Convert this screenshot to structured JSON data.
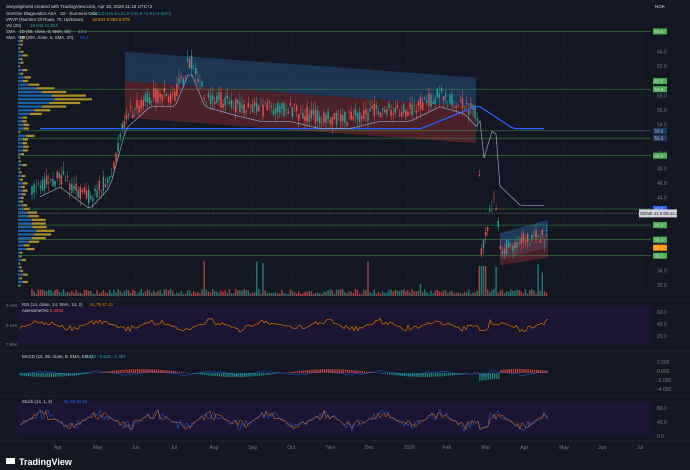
{
  "header": {
    "credit": "oneyelgimest created with TradingView.com, Apr 10, 2026 11:18 UTC+2",
    "currency": "NOK",
    "symbol_line": "GenOne Diagnostics ASA · 1D · Euronext Oslo",
    "symbol_values": "O41.2 H41.6 L41.0 C41.9 +1.9 (+4.63%)",
    "vrvp_line": "VRVP (Number Of Rows, 70, Up/Down)",
    "vrvp_values": "18.841 9.954 8.87K",
    "vol_line": "Vol (20)",
    "vol_values": "16.644 11.324",
    "sma50_line": "SMA · 1D (50, close, 0, SMA, 50)",
    "sma50_value": "43.4",
    "sma200_line": "SMA · 1D (200, close, 0, SMA, 20)",
    "sma200_value": "51.2"
  },
  "rsi": {
    "label": "RSI (14, close, 14, SMA, 14, 2)",
    "values": "61.79 47.41"
  },
  "ao": {
    "label": "AwesomeOsc",
    "value": "0.4664"
  },
  "macd": {
    "label": "MACD (12, 26, close, 9, EMA, EMA)",
    "values": "0.828 −0.525 −1.353"
  },
  "stoch": {
    "label": "Stoch (14, 1, 3)",
    "values": "91.55 90.49"
  },
  "left_volume_labels": [
    "9.45K",
    "9.24K",
    "7.86K"
  ],
  "brand": {
    "name": "TradingView"
  },
  "colors": {
    "bg": "#131722",
    "bull": "#26a69a",
    "bear": "#ef5350",
    "sma200": "#2962ff",
    "sma50": "#8fa3c8",
    "level": "#4caf50",
    "channel_top": "#2a5c8f",
    "channel_bottom": "#7a2a30",
    "rsi": "#f57c00"
  },
  "chart_data": {
    "type": "candlestick",
    "x_ticks": [
      "Apr",
      "May",
      "Jun",
      "Jul",
      "Aug",
      "Sep",
      "Oct",
      "Nov",
      "Dec",
      "2026",
      "Feb",
      "Mar",
      "Apr",
      "May",
      "Jun",
      "Jul"
    ],
    "ylim": [
      31,
      67
    ],
    "y_ticks": [
      32.0,
      34.0,
      36.0,
      38.0,
      40.0,
      42.0,
      44.0,
      46.0,
      48.0,
      50.0,
      52.0,
      54.0,
      56.0,
      58.0,
      60.0,
      62.0,
      64.0
    ],
    "price_tags": [
      {
        "value": 66.8,
        "text": "66.8",
        "color": "#4caf50"
      },
      {
        "value": 60.0,
        "text": "60.0",
        "color": "#4caf50"
      },
      {
        "value": 58.9,
        "text": "58.9",
        "color": "#4caf50"
      },
      {
        "value": 53.2,
        "text": "53.2",
        "color": "#1e3a5f"
      },
      {
        "value": 52.2,
        "text": "52.2",
        "color": "#1e3a5f"
      },
      {
        "value": 49.8,
        "text": "49.8",
        "color": "#4caf50"
      },
      {
        "value": 42.5,
        "text": "42.5",
        "color": "#2962ff"
      },
      {
        "value": 40.3,
        "text": "40.3",
        "color": "#4caf50"
      },
      {
        "value": 38.3,
        "text": "38.3",
        "color": "#4caf50"
      },
      {
        "value": 37.2,
        "text": "37.2",
        "color": "#ff9800"
      },
      {
        "value": 36.1,
        "text": "36.1",
        "color": "#4caf50"
      }
    ],
    "last_price_tag": {
      "value": 41.9,
      "text": "GENE 41.9 00:41:25"
    },
    "horizontal_levels": [
      66.8,
      58.9,
      53.2,
      52.2,
      49.8,
      42.5,
      40.3,
      38.3,
      36.1
    ],
    "rsi_range": [
      20,
      80
    ],
    "rsi_ticks": [
      60.0,
      40.0,
      20.0
    ],
    "macd_ticks": [
      2.0,
      0.0,
      -2.0,
      -4.0
    ],
    "stoch_ticks": [
      80.0,
      40.0,
      0.0
    ]
  }
}
